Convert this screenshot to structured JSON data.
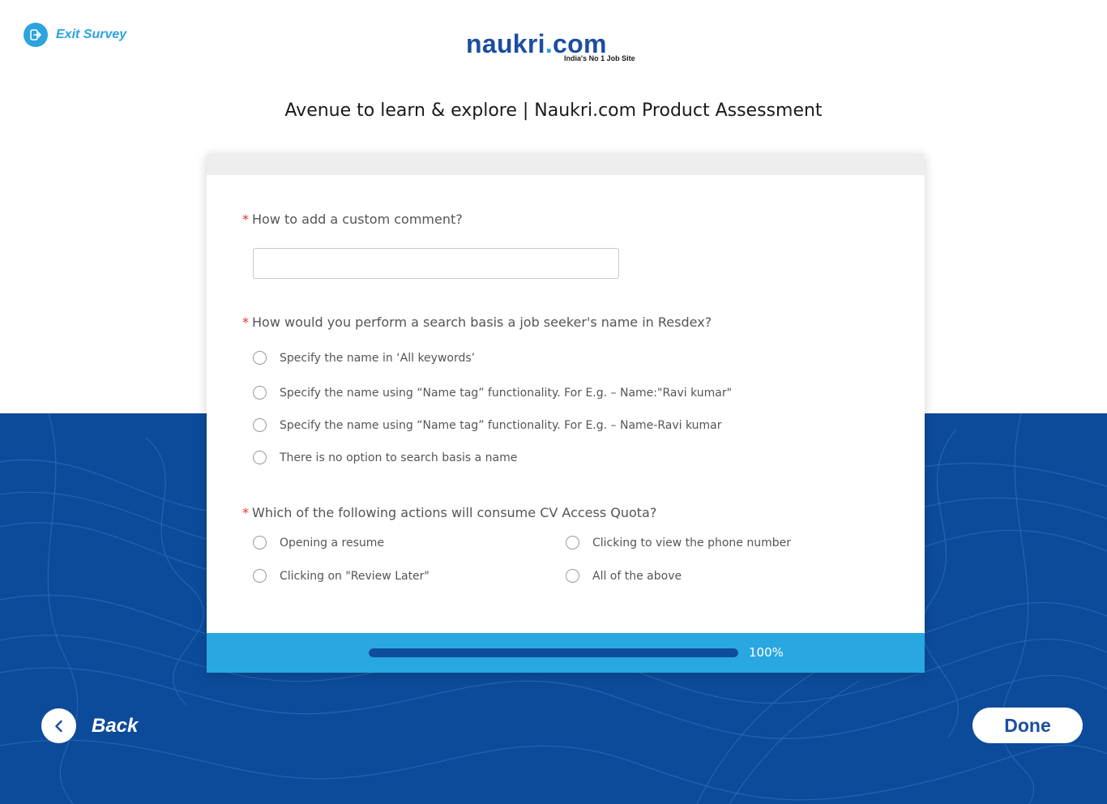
{
  "header": {
    "exit_label": "Exit Survey",
    "logo_text": "naukri",
    "logo_dot": ".",
    "logo_com": "com",
    "logo_tagline": "India's No 1 Job Site",
    "title": "Avenue to learn & explore | Naukri.com Product Assessment"
  },
  "questions": [
    {
      "required_mark": "*",
      "text": "How to add a custom comment?",
      "type": "text",
      "value": ""
    },
    {
      "required_mark": "*",
      "text": "How would you perform a search basis a job seeker's name in Resdex?",
      "type": "radio",
      "options": [
        "Specify the name in ‘All keywords’",
        "Specify the name using “Name tag” functionality. For E.g. – Name:\"Ravi kumar\"",
        "Specify the name using “Name tag” functionality. For E.g. – Name-Ravi kumar",
        "There is no option to search basis a name"
      ]
    },
    {
      "required_mark": "*",
      "text": "Which of the following actions will consume CV Access Quota?",
      "type": "radio",
      "options": [
        "Opening a resume",
        "Clicking to view the phone number",
        "Clicking on \"Review Later\"",
        "All of the above"
      ]
    }
  ],
  "progress": {
    "value": 1.0,
    "label": "100%"
  },
  "footer": {
    "back_label": "Back",
    "done_label": "Done"
  },
  "colors": {
    "brand_blue": "#1d4ea0",
    "accent_blue": "#29a7e1",
    "bg_dark": "#0c4b9a",
    "required": "#e8332a"
  }
}
